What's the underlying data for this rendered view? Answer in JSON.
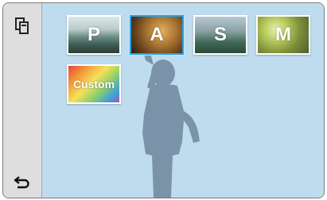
{
  "sidebar": {
    "top_icon": "multi-window-icon",
    "bottom_icon": "back-arrow-icon"
  },
  "modes": [
    {
      "label": "P",
      "selected": false
    },
    {
      "label": "A",
      "selected": true
    },
    {
      "label": "S",
      "selected": false
    },
    {
      "label": "M",
      "selected": false
    },
    {
      "label": "Custom",
      "selected": false
    }
  ],
  "colors": {
    "background": "#bfdcef",
    "sidebar": "#dedede",
    "selection": "#27a3e0",
    "silhouette": "#7b93a8"
  }
}
